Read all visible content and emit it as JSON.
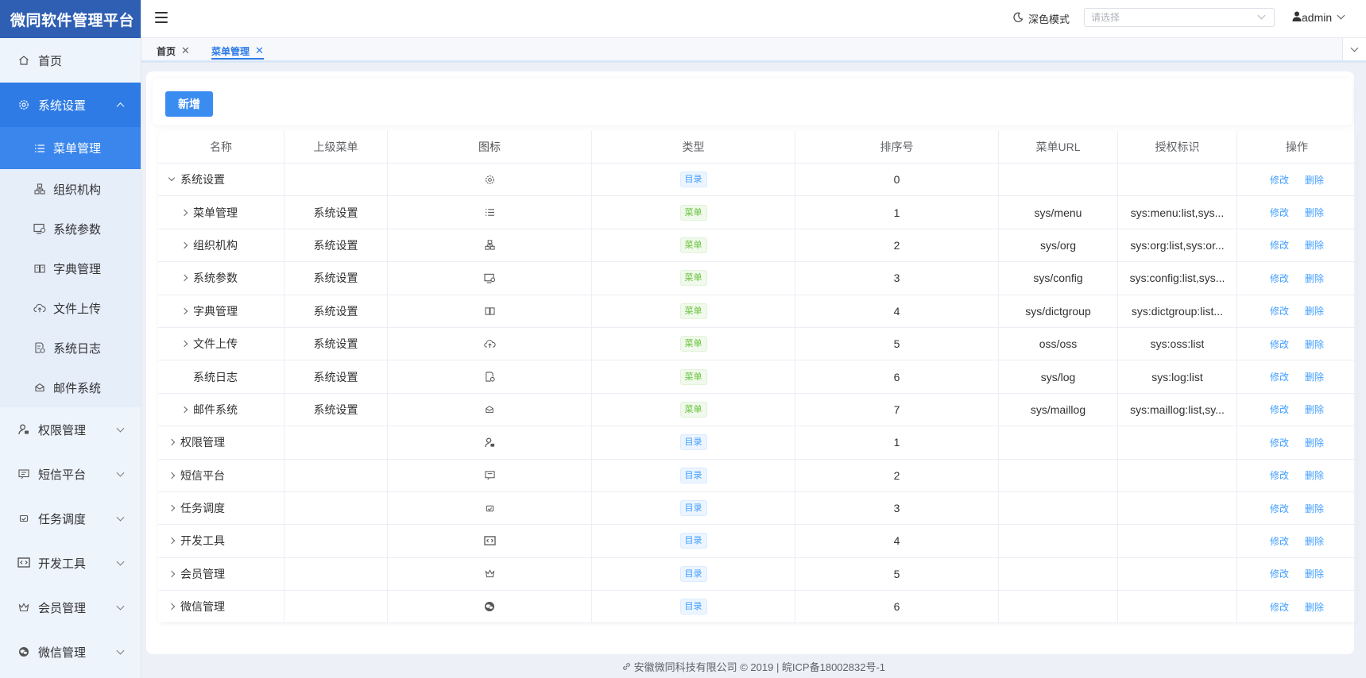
{
  "brand": "微同软件管理平台",
  "sidebar": {
    "items": [
      {
        "label": "首页",
        "icon": "home-icon"
      },
      {
        "label": "系统设置",
        "icon": "gear-icon"
      },
      {
        "label": "权限管理",
        "icon": "user-lock-icon"
      },
      {
        "label": "短信平台",
        "icon": "message-icon"
      },
      {
        "label": "任务调度",
        "icon": "schedule-icon"
      },
      {
        "label": "开发工具",
        "icon": "code-icon"
      },
      {
        "label": "会员管理",
        "icon": "crown-icon"
      },
      {
        "label": "微信管理",
        "icon": "wechat-icon"
      }
    ],
    "sub_items": [
      {
        "label": "菜单管理",
        "icon": "list-icon"
      },
      {
        "label": "组织机构",
        "icon": "org-icon"
      },
      {
        "label": "系统参数",
        "icon": "monitor-settings-icon"
      },
      {
        "label": "字典管理",
        "icon": "book-icon"
      },
      {
        "label": "文件上传",
        "icon": "cloud-upload-icon"
      },
      {
        "label": "系统日志",
        "icon": "log-icon"
      },
      {
        "label": "邮件系统",
        "icon": "mail-icon"
      }
    ]
  },
  "header": {
    "dark_mode_label": "深色模式",
    "select_placeholder": "请选择",
    "username": "admin"
  },
  "tabs": [
    {
      "label": "首页"
    },
    {
      "label": "菜单管理"
    }
  ],
  "toolbar": {
    "add_label": "新增"
  },
  "table": {
    "columns": [
      "名称",
      "上级菜单",
      "图标",
      "类型",
      "排序号",
      "菜单URL",
      "授权标识",
      "操作"
    ],
    "edit_label": "修改",
    "delete_label": "删除",
    "rows": [
      {
        "name": "系统设置",
        "parent": "",
        "icon": "gear-icon",
        "type": "目录",
        "order": "0",
        "url": "",
        "perm": ""
      },
      {
        "name": "菜单管理",
        "parent": "系统设置",
        "icon": "list-icon",
        "type": "菜单",
        "order": "1",
        "url": "sys/menu",
        "perm": "sys:menu:list,sys..."
      },
      {
        "name": "组织机构",
        "parent": "系统设置",
        "icon": "org-icon",
        "type": "菜单",
        "order": "2",
        "url": "sys/org",
        "perm": "sys:org:list,sys:or..."
      },
      {
        "name": "系统参数",
        "parent": "系统设置",
        "icon": "monitor-settings-icon",
        "type": "菜单",
        "order": "3",
        "url": "sys/config",
        "perm": "sys:config:list,sys..."
      },
      {
        "name": "字典管理",
        "parent": "系统设置",
        "icon": "book-icon",
        "type": "菜单",
        "order": "4",
        "url": "sys/dictgroup",
        "perm": "sys:dictgroup:list..."
      },
      {
        "name": "文件上传",
        "parent": "系统设置",
        "icon": "cloud-upload-icon",
        "type": "菜单",
        "order": "5",
        "url": "oss/oss",
        "perm": "sys:oss:list"
      },
      {
        "name": "系统日志",
        "parent": "系统设置",
        "icon": "log-icon",
        "type": "菜单",
        "order": "6",
        "url": "sys/log",
        "perm": "sys:log:list"
      },
      {
        "name": "邮件系统",
        "parent": "系统设置",
        "icon": "mail-icon",
        "type": "菜单",
        "order": "7",
        "url": "sys/maillog",
        "perm": "sys:maillog:list,sy..."
      },
      {
        "name": "权限管理",
        "parent": "",
        "icon": "user-lock-icon",
        "type": "目录",
        "order": "1",
        "url": "",
        "perm": ""
      },
      {
        "name": "短信平台",
        "parent": "",
        "icon": "message-icon",
        "type": "目录",
        "order": "2",
        "url": "",
        "perm": ""
      },
      {
        "name": "任务调度",
        "parent": "",
        "icon": "schedule-icon",
        "type": "目录",
        "order": "3",
        "url": "",
        "perm": ""
      },
      {
        "name": "开发工具",
        "parent": "",
        "icon": "code-icon",
        "type": "目录",
        "order": "4",
        "url": "",
        "perm": ""
      },
      {
        "name": "会员管理",
        "parent": "",
        "icon": "crown-icon",
        "type": "目录",
        "order": "5",
        "url": "",
        "perm": ""
      },
      {
        "name": "微信管理",
        "parent": "",
        "icon": "wechat-icon",
        "type": "目录",
        "order": "6",
        "url": "",
        "perm": ""
      }
    ]
  },
  "footer": "安徽微同科技有限公司 © 2019 | 皖ICP备18002832号-1",
  "colors": {
    "brand": "#2f5fb3",
    "accent": "#2e7be6",
    "link": "#409eff",
    "menu_tag": "#67c23a"
  }
}
